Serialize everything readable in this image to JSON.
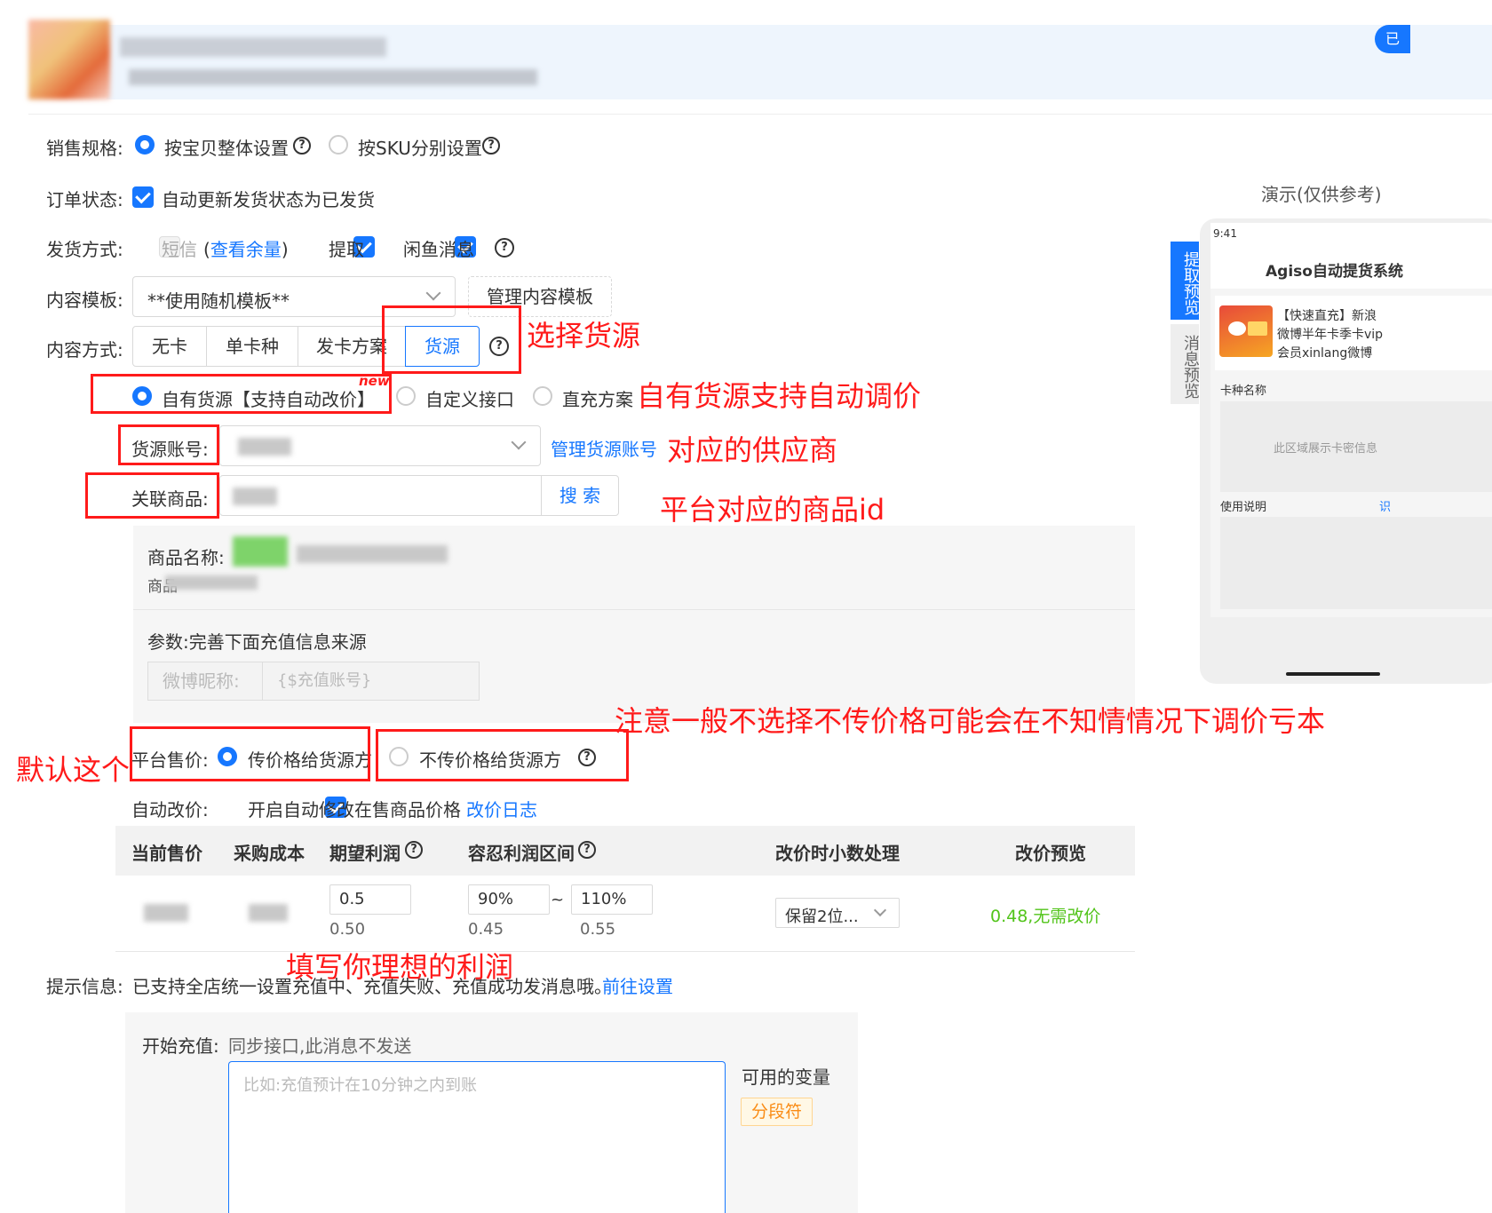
{
  "labels": {
    "sales_spec": "销售规格:",
    "order_status": "订单状态:",
    "delivery": "发货方式:",
    "template": "内容模板:",
    "content_mode": "内容方式:",
    "source_account": "货源账号:",
    "related_product": "关联商品:",
    "platform_price": "平台售价:",
    "auto_price": "自动改价:",
    "tip_info": "提示信息:"
  },
  "sales_spec": {
    "opt1": "按宝贝整体设置",
    "opt2": "按SKU分别设置"
  },
  "order_status": {
    "auto_update": "自动更新发货状态为已发货"
  },
  "delivery": {
    "sms": "短信",
    "sms_open": "(",
    "check_balance": "查看余量",
    "sms_close": ")",
    "pickup": "提取",
    "xianyu": "闲鱼消息"
  },
  "template": {
    "selected": "**使用随机模板**",
    "manage": "管理内容模板"
  },
  "content_tabs": [
    "无卡",
    "单卡种",
    "发卡方案",
    "货源"
  ],
  "source_type": {
    "own": "自有货源",
    "own_tag": "【支持自动改价】",
    "new_badge": "new",
    "custom": "自定义接口",
    "direct": "直充方案"
  },
  "source_account": {
    "manage": "管理货源账号"
  },
  "related_product": {
    "search": "搜 索"
  },
  "product_info": {
    "name_label": "商品名称:",
    "id_label": "商品",
    "params": "参数:完善下面充值信息来源",
    "param_name": "微博昵称:",
    "param_value": "{$充值账号}"
  },
  "platform_price": {
    "opt1": "传价格给货源方",
    "opt2": "不传价格给货源方"
  },
  "auto_price": {
    "enable": "开启自动修改在售商品价格",
    "log": "改价日志"
  },
  "table": {
    "headers": [
      "当前售价",
      "采购成本",
      "期望利润",
      "容忍利润区间",
      "改价时小数处理",
      "改价预览"
    ],
    "profit": "0.5",
    "profit_sub": "0.50",
    "range_low": "90%",
    "range_low_sub": "0.45",
    "tilde": "~",
    "range_high": "110%",
    "range_high_sub": "0.55",
    "decimal": "保留2位...",
    "preview": "0.48,无需改价"
  },
  "tip": {
    "text": "已支持全店统一设置充值中、充值失败、充值成功发消息哦。",
    "link": "前往设置"
  },
  "recharge": {
    "label": "开始充值:",
    "desc": "同步接口,此消息不发送",
    "placeholder": "比如:充值预计在10分钟之内到账",
    "vars": "可用的变量",
    "seg": "分段符"
  },
  "demo": {
    "title": "演示(仅供参考)",
    "time": "9:41",
    "app_title": "Agiso自动提货系统",
    "side_tab1": "提取预览",
    "side_tab2": "消息预览",
    "product": "【快速直充】新浪微博半年卡季卡vip会员xinlang微博",
    "card_name": "卡种名称",
    "card_area": "此区域展示卡密信息",
    "usage": "使用说明",
    "usage_link": "识",
    "top_btn": "已"
  },
  "annotations": {
    "a1": "选择货源",
    "a2": "自有货源支持自动调价",
    "a3": "对应的供应商",
    "a4": "平台对应的商品id",
    "a5": "注意一般不选择不传价格可能会在不知情情况下调价亏本",
    "a6": "默认这个",
    "a7": "填写你理想的利润"
  },
  "colors": {
    "primary": "#1677ff",
    "annotation": "#ff1a1a",
    "preview_green": "#52c41a"
  }
}
